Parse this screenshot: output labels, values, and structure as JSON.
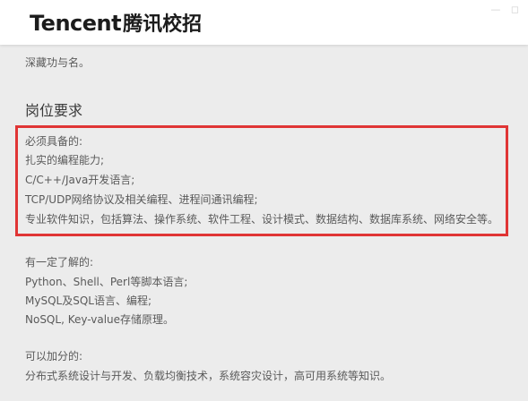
{
  "header": {
    "logo_en": "Tencent",
    "logo_cn": "腾讯校招"
  },
  "content": {
    "intro_tail": "深藏功与名。",
    "section_title": "岗位要求",
    "required": {
      "heading": "必须具备的:",
      "items": [
        "扎实的编程能力;",
        "C/C++/Java开发语言;",
        "TCP/UDP网络协议及相关编程、进程间通讯编程;",
        "专业软件知识，包括算法、操作系统、软件工程、设计模式、数据结构、数据库系统、网络安全等。"
      ]
    },
    "preferred": {
      "heading": "有一定了解的:",
      "items": [
        "Python、Shell、Perl等脚本语言;",
        "MySQL及SQL语言、编程;",
        "NoSQL, Key-value存储原理。"
      ]
    },
    "bonus": {
      "heading": "可以加分的:",
      "items": [
        "分布式系统设计与开发、负载均衡技术，系统容灾设计，高可用系统等知识。"
      ]
    }
  },
  "colors": {
    "highlight_border": "#e03535",
    "header_bg": "#ffffff",
    "page_bg": "#ececec"
  }
}
